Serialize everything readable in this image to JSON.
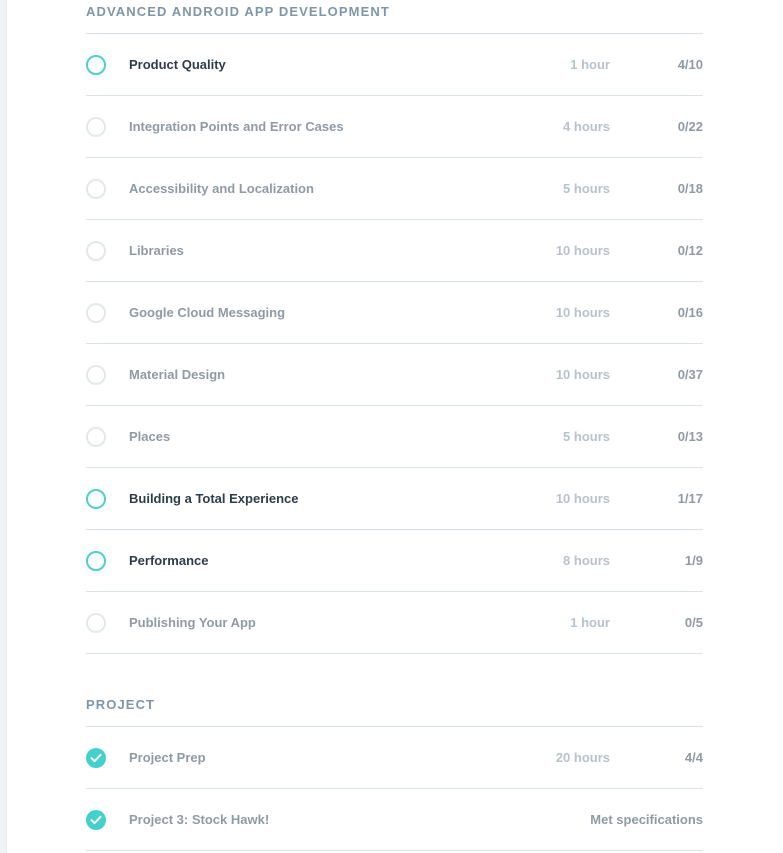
{
  "sections": [
    {
      "title": "ADVANCED ANDROID APP DEVELOPMENT",
      "lessons": [
        {
          "name": "Product Quality",
          "duration": "1 hour",
          "progress": "4/10",
          "status": "in-progress"
        },
        {
          "name": "Integration Points and Error Cases",
          "duration": "4 hours",
          "progress": "0/22",
          "status": "not-started"
        },
        {
          "name": "Accessibility and Localization",
          "duration": "5 hours",
          "progress": "0/18",
          "status": "not-started"
        },
        {
          "name": "Libraries",
          "duration": "10 hours",
          "progress": "0/12",
          "status": "not-started"
        },
        {
          "name": "Google Cloud Messaging",
          "duration": "10 hours",
          "progress": "0/16",
          "status": "not-started"
        },
        {
          "name": "Material Design",
          "duration": "10 hours",
          "progress": "0/37",
          "status": "not-started"
        },
        {
          "name": "Places",
          "duration": "5 hours",
          "progress": "0/13",
          "status": "not-started"
        },
        {
          "name": "Building a Total Experience",
          "duration": "10 hours",
          "progress": "1/17",
          "status": "in-progress"
        },
        {
          "name": "Performance",
          "duration": "8 hours",
          "progress": "1/9",
          "status": "in-progress"
        },
        {
          "name": "Publishing Your App",
          "duration": "1 hour",
          "progress": "0/5",
          "status": "not-started"
        }
      ]
    },
    {
      "title": "PROJECT",
      "lessons": [
        {
          "name": "Project Prep",
          "duration": "20 hours",
          "progress": "4/4",
          "status": "complete"
        },
        {
          "name": "Project 3: Stock Hawk!",
          "duration": "",
          "progress": "Met specifications",
          "status": "complete"
        }
      ]
    }
  ],
  "colors": {
    "accent": "#44d0cb",
    "title": "#7d97a8",
    "active_text": "#2e3d49",
    "muted_text": "#8e9ba5",
    "duration_text": "#b6c3cc",
    "divider": "#dbe2e8"
  },
  "icons": {
    "in-progress": "progress-ring-icon",
    "not-started": "empty-circle-icon",
    "complete": "checkmark-circle-icon"
  }
}
